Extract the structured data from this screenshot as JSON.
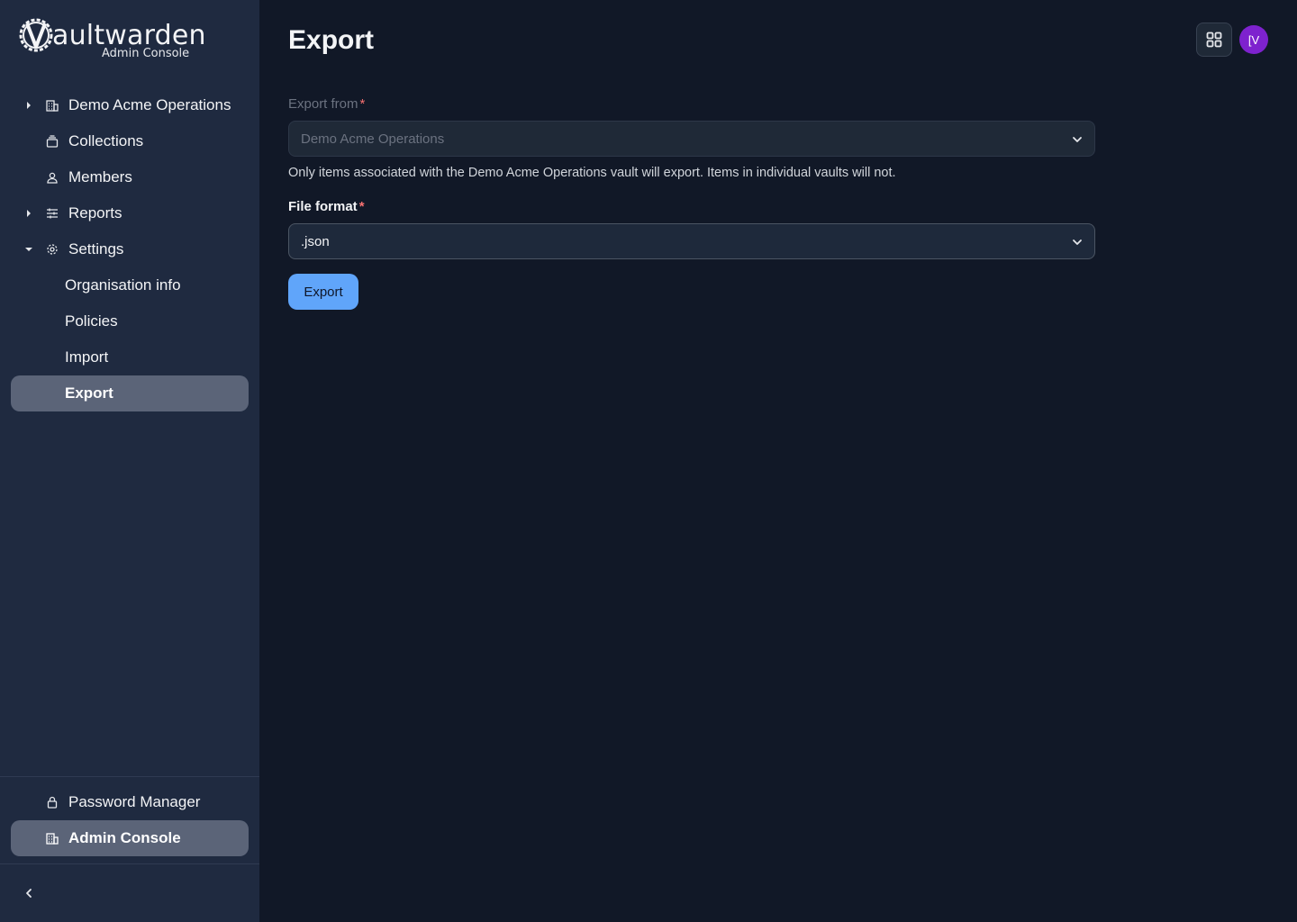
{
  "brand": {
    "logo_word": "aultwarden",
    "logo_sub": "Admin Console"
  },
  "sidebar": {
    "items": [
      {
        "label": "Demo Acme Operations",
        "icon": "building-icon",
        "caret": "right"
      },
      {
        "label": "Collections",
        "icon": "collection-icon"
      },
      {
        "label": "Members",
        "icon": "user-icon"
      },
      {
        "label": "Reports",
        "icon": "sliders-icon",
        "caret": "right"
      },
      {
        "label": "Settings",
        "icon": "gear-icon",
        "caret": "down"
      },
      {
        "label": "Organisation info"
      },
      {
        "label": "Policies"
      },
      {
        "label": "Import"
      },
      {
        "label": "Export",
        "active": true
      }
    ],
    "bottom": [
      {
        "label": "Password Manager",
        "icon": "lock-icon"
      },
      {
        "label": "Admin Console",
        "icon": "building-icon",
        "active": true
      }
    ]
  },
  "header": {
    "title": "Export",
    "avatar_initials": "[V"
  },
  "form": {
    "export_from": {
      "label": "Export from",
      "required": "*",
      "value": "Demo Acme Operations"
    },
    "help_text": "Only items associated with the Demo Acme Operations vault will export. Items in individual vaults will not.",
    "file_format": {
      "label": "File format",
      "required": "*",
      "value": ".json"
    },
    "submit_label": "Export"
  },
  "colors": {
    "accent": "#60a5fa",
    "avatar": "#7e22ce",
    "sidebar_bg": "#1f2a40",
    "main_bg": "#111827",
    "active_item": "#5b6478"
  }
}
